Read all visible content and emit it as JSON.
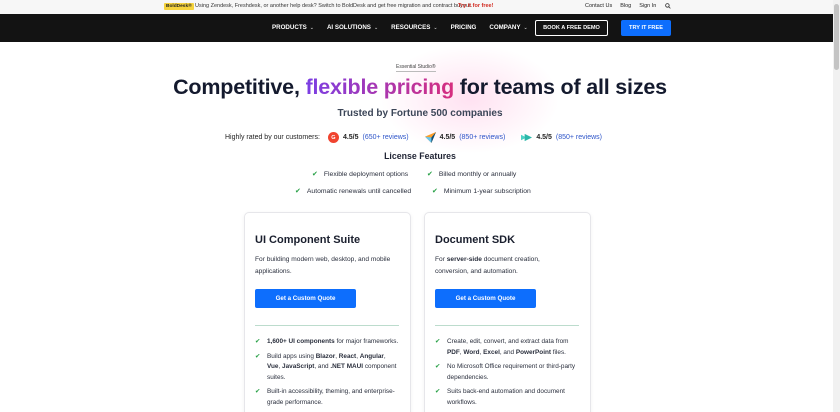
{
  "announcement": {
    "tag": "BoldDesk®",
    "message": "Using Zendesk, Freshdesk, or another help desk? Switch to BoldDesk and get free migration and contract buyout.",
    "cta": "Try it for free!",
    "links": [
      "Contact Us",
      "Blog",
      "Sign In"
    ],
    "search_icon": "search-icon"
  },
  "nav": {
    "items": [
      {
        "label": "PRODUCTS",
        "dropdown": true
      },
      {
        "label": "AI SOLUTIONS",
        "dropdown": true
      },
      {
        "label": "RESOURCES",
        "dropdown": true
      },
      {
        "label": "PRICING",
        "dropdown": false
      },
      {
        "label": "COMPANY",
        "dropdown": true
      }
    ],
    "demo_button": "BOOK A FREE DEMO",
    "try_button": "TRY IT FREE"
  },
  "hero": {
    "badge": "Essential Studio®",
    "headline_pre": "Competitive, ",
    "headline_highlight": "flexible pricing",
    "headline_post": " for teams of all sizes",
    "trusted": "Trusted by Fortune 500 companies",
    "ratings_label": "Highly rated by our customers:",
    "ratings": [
      {
        "icon": "g2-icon",
        "score": "4.5/5",
        "reviews": "(650+ reviews)"
      },
      {
        "icon": "capterra-icon",
        "score": "4.5/5",
        "reviews": "(850+ reviews)"
      },
      {
        "icon": "getapp-icon",
        "score": "4.5/5",
        "reviews": "(850+ reviews)"
      }
    ]
  },
  "license": {
    "title": "License Features",
    "features": [
      "Flexible deployment options",
      "Billed monthly or annually",
      "Automatic renewals until cancelled",
      "Minimum 1-year subscription"
    ]
  },
  "cards": [
    {
      "title": "UI Component Suite",
      "desc": "For building modern web, desktop, and mobile applications.",
      "button": "Get a Custom Quote",
      "items": [
        {
          "pre": "",
          "b1": "1,600+ UI components",
          "mid": " for major frameworks."
        },
        {
          "text": "Build apps using Blazor, React, Angular, Vue, JavaScript, and .NET MAUI component suites."
        },
        {
          "text": "Built-in accessibility, theming, and enterprise-grade performance."
        }
      ]
    },
    {
      "title": "Document SDK",
      "desc_pre": "For ",
      "desc_bold": "server-side",
      "desc_post": " document creation, conversion, and automation.",
      "button": "Get a Custom Quote",
      "items": [
        {
          "text": "Create, edit, convert, and extract data from PDF, Word, Excel, and PowerPoint files."
        },
        {
          "text": "No Microsoft Office requirement or third-party dependencies."
        },
        {
          "text": "Suits back-end automation and document workflows."
        }
      ]
    }
  ],
  "colors": {
    "primary": "#0d6efd",
    "nav_bg": "#131313",
    "check": "#27a046",
    "gradient_start": "#7b3fe4",
    "gradient_end": "#d62e7e"
  }
}
